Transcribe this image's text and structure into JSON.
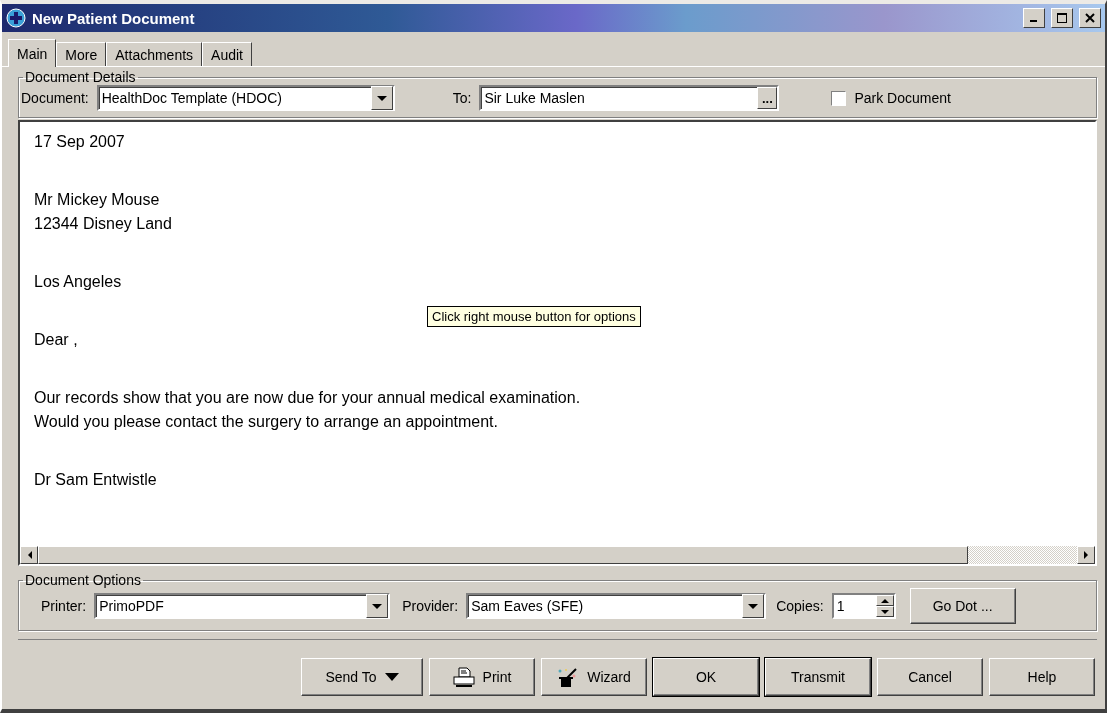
{
  "window": {
    "title": "New Patient Document"
  },
  "tabs": [
    {
      "label": "Main",
      "selected": true
    },
    {
      "label": "More",
      "selected": false
    },
    {
      "label": "Attachments",
      "selected": false
    },
    {
      "label": "Audit",
      "selected": false
    }
  ],
  "document_details": {
    "legend": "Document Details",
    "document_label": "Document:",
    "document_value": "HealthDoc Template (HDOC)",
    "to_label": "To:",
    "to_value": "Sir Luke Maslen",
    "browse_button": "...",
    "park_document": {
      "label": "Park Document",
      "checked": false
    }
  },
  "letter": {
    "paragraphs": [
      [
        "17 Sep 2007"
      ],
      [
        "Mr Mickey Mouse",
        "12344 Disney Land"
      ],
      [
        "Los Angeles"
      ],
      [
        "Dear ,"
      ],
      [
        "Our records show that you are now due for your annual medical examination.",
        "Would you please contact the surgery to arrange an appointment."
      ],
      [
        "Dr Sam Entwistle"
      ]
    ],
    "tooltip": "Click right mouse button for options"
  },
  "document_options": {
    "legend": "Document Options",
    "printer_label": "Printer:",
    "printer_value": "PrimoPDF",
    "provider_label": "Provider:",
    "provider_value": "Sam Eaves (SFE)",
    "copies_label": "Copies:",
    "copies_value": "1",
    "go_dot_button": "Go Dot ..."
  },
  "buttons": [
    {
      "label": "Send To",
      "kind": "menu",
      "default": false
    },
    {
      "label": "Print",
      "kind": "print",
      "default": false
    },
    {
      "label": "Wizard",
      "kind": "wizard",
      "default": false
    },
    {
      "label": "OK",
      "kind": "plain",
      "default": true
    },
    {
      "label": "Transmit",
      "kind": "plain",
      "default": true
    },
    {
      "label": "Cancel",
      "kind": "plain",
      "default": false
    },
    {
      "label": "Help",
      "kind": "plain",
      "default": false
    }
  ]
}
